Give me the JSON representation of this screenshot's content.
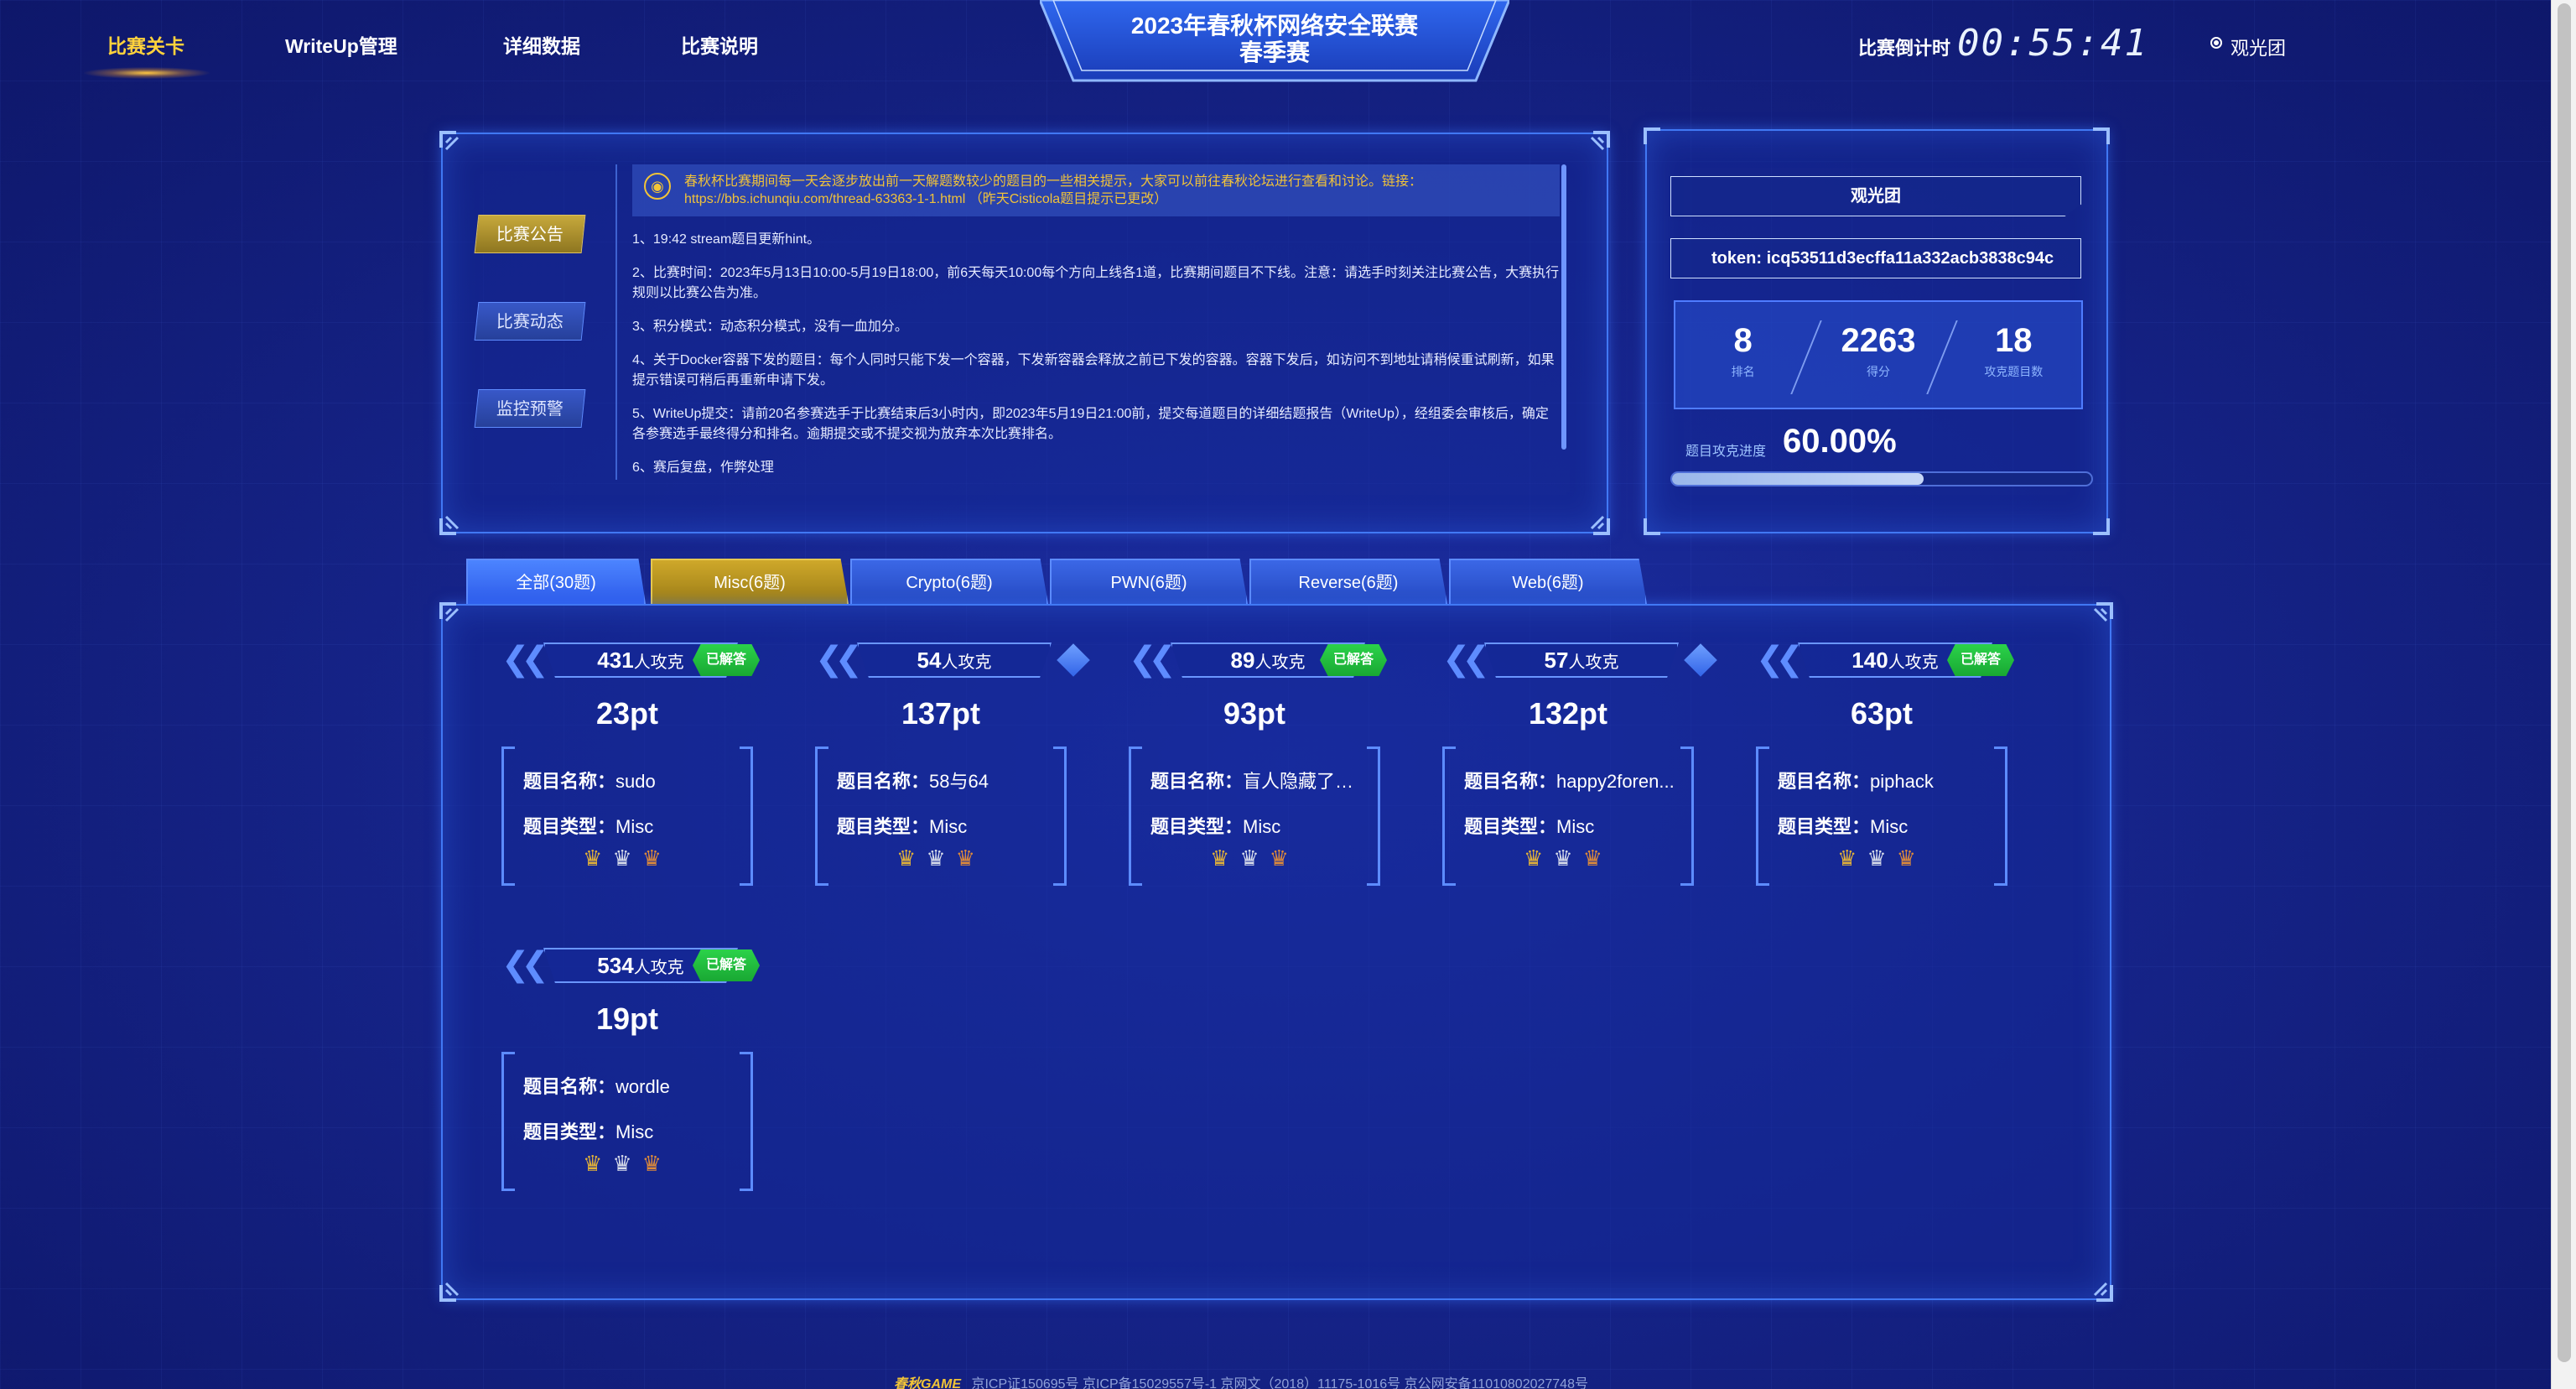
{
  "nav": {
    "items": [
      "比赛关卡",
      "WriteUp管理",
      "详细数据",
      "比赛说明"
    ],
    "title_line1": "2023年春秋杯网络安全联赛",
    "title_line2": "春季赛",
    "countdown_label": "比赛倒计时",
    "countdown": "00:55:41",
    "user": "观光团"
  },
  "announcement": {
    "side_buttons": [
      "比赛公告",
      "比赛动态",
      "监控预警"
    ],
    "notice_icon": "megaphone-icon",
    "notice": "春秋杯比赛期间每一天会逐步放出前一天解题数较少的题目的一些相关提示，大家可以前往春秋论坛进行查看和讨论。链接：https://bbs.ichunqiu.com/thread-63363-1-1.html （昨天Cisticola题目提示已更改）",
    "items": [
      "1、19:42 stream题目更新hint。",
      "2、比赛时间：2023年5月13日10:00-5月19日18:00，前6天每天10:00每个方向上线各1道，比赛期间题目不下线。注意：请选手时刻关注比赛公告，大赛执行规则以比赛公告为准。",
      "3、积分模式：动态积分模式，没有一血加分。",
      "4、关于Docker容器下发的题目：每个人同时只能下发一个容器，下发新容器会释放之前已下发的容器。容器下发后，如访问不到地址请稍候重试刷新，如果提示错误可稍后再重新申请下发。",
      "5、WriteUp提交：请前20名参赛选手于比赛结束后3小时内，即2023年5月19日21:00前，提交每道题目的详细结题报告（WriteUp），经组委会审核后，确定各参赛选手最终得分和排名。逾期提交或不提交视为放弃本次比赛排名。",
      "6、赛后复盘，作弊处理"
    ]
  },
  "stats": {
    "team_name": "观光团",
    "token_label": "token:",
    "token": "icq53511d3ecffa11a332acb3838c94c",
    "cells": [
      {
        "value": "8",
        "label": "排名"
      },
      {
        "value": "2263",
        "label": "得分"
      },
      {
        "value": "18",
        "label": "攻克题目数"
      }
    ],
    "progress_label": "题目攻克进度",
    "progress_text": "60.00%",
    "progress": 0.6
  },
  "tabs": [
    "全部(30题)",
    "Misc(6题)",
    "Crypto(6题)",
    "PWN(6题)",
    "Reverse(6题)",
    "Web(6题)"
  ],
  "labels": {
    "count_unit": "人攻克",
    "solved": "已解答",
    "name_label": "题目名称",
    "type_label": "题目类型",
    "colon": "："
  },
  "challenges": [
    {
      "count": "431",
      "points": "23pt",
      "name": "sudo",
      "type": "Misc",
      "solved": true
    },
    {
      "count": "54",
      "points": "137pt",
      "name": "58与64",
      "type": "Misc",
      "solved": false
    },
    {
      "count": "89",
      "points": "93pt",
      "name": "盲人隐藏了起来",
      "type": "Misc",
      "solved": true
    },
    {
      "count": "57",
      "points": "132pt",
      "name": "happy2foren...",
      "type": "Misc",
      "solved": false
    },
    {
      "count": "140",
      "points": "63pt",
      "name": "piphack",
      "type": "Misc",
      "solved": true
    },
    {
      "count": "534",
      "points": "19pt",
      "name": "wordle",
      "type": "Misc",
      "solved": true
    }
  ],
  "crown_icons": [
    "crown-gold-icon",
    "crown-silver-icon",
    "crown-bronze-icon"
  ],
  "footer": {
    "logo": "春秋GAME",
    "text": "京ICP证150695号 京ICP备15029557号-1 京网文（2018）11175-1016号 京公网安备11010802027748号"
  },
  "colors": {
    "background": "#16248a",
    "accent_gold": "#ffd23c",
    "solved_green": "#2bd24a",
    "border_blue": "#4f7cff"
  }
}
